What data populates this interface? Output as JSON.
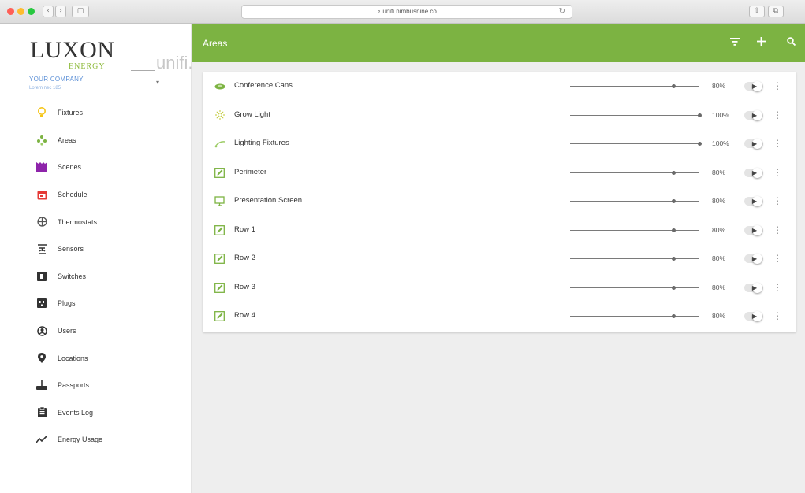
{
  "browser": {
    "url": "unifi.nimbusnine.co"
  },
  "sidebar": {
    "logo": {
      "main": "LUXON",
      "sub": "ENERGY",
      "product": "unifi."
    },
    "company": "YOUR COMPANY",
    "company_sub": "Lorem nec 185",
    "items": [
      {
        "label": "Fixtures",
        "icon": "lightbulb-icon",
        "color": "#f5c518"
      },
      {
        "label": "Areas",
        "icon": "areas-icon",
        "color": "#7cb342"
      },
      {
        "label": "Scenes",
        "icon": "scenes-icon",
        "color": "#8e24aa"
      },
      {
        "label": "Schedule",
        "icon": "calendar-icon",
        "color": "#e53935"
      },
      {
        "label": "Thermostats",
        "icon": "thermostat-icon",
        "color": "#555555"
      },
      {
        "label": "Sensors",
        "icon": "sensor-icon",
        "color": "#333333"
      },
      {
        "label": "Switches",
        "icon": "switch-icon",
        "color": "#333333"
      },
      {
        "label": "Plugs",
        "icon": "plug-icon",
        "color": "#333333"
      },
      {
        "label": "Users",
        "icon": "user-icon",
        "color": "#333333"
      },
      {
        "label": "Locations",
        "icon": "location-pin-icon",
        "color": "#333333"
      },
      {
        "label": "Passports",
        "icon": "passport-icon",
        "color": "#333333"
      },
      {
        "label": "Events Log",
        "icon": "clipboard-icon",
        "color": "#333333"
      },
      {
        "label": "Energy Usage",
        "icon": "trend-icon",
        "color": "#333333"
      }
    ]
  },
  "header": {
    "title": "Areas",
    "accent": "#7cb342",
    "actions": [
      "filter-icon",
      "add-icon",
      "search-icon"
    ]
  },
  "areas": [
    {
      "name": "Conference Cans",
      "icon": "lamp-icon",
      "level": 80,
      "percent": "80%"
    },
    {
      "name": "Grow Light",
      "icon": "sun-icon",
      "level": 100,
      "percent": "100%"
    },
    {
      "name": "Lighting Fixtures",
      "icon": "fixture-icon",
      "level": 100,
      "percent": "100%"
    },
    {
      "name": "Perimeter",
      "icon": "edit-icon",
      "level": 80,
      "percent": "80%"
    },
    {
      "name": "Presentation Screen",
      "icon": "monitor-icon",
      "level": 80,
      "percent": "80%"
    },
    {
      "name": "Row 1",
      "icon": "edit-icon",
      "level": 80,
      "percent": "80%"
    },
    {
      "name": "Row 2",
      "icon": "edit-icon",
      "level": 80,
      "percent": "80%"
    },
    {
      "name": "Row 3",
      "icon": "edit-icon",
      "level": 80,
      "percent": "80%"
    },
    {
      "name": "Row 4",
      "icon": "edit-icon",
      "level": 80,
      "percent": "80%"
    }
  ]
}
